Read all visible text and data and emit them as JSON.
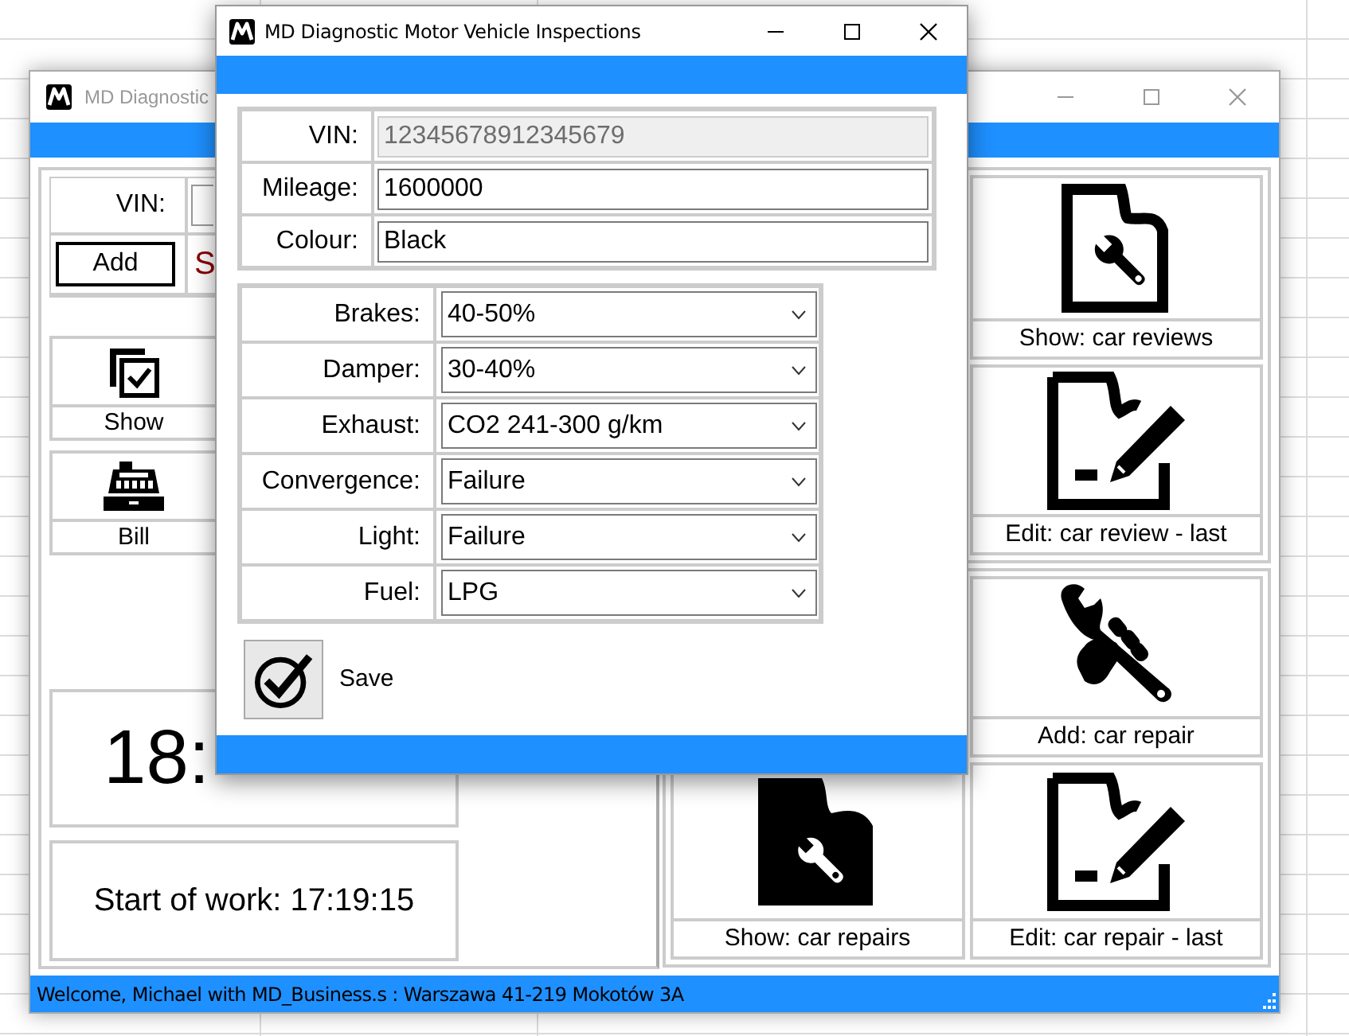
{
  "back_window": {
    "title": "MD Diagnostic",
    "vin_label": "VIN:",
    "add_button": "Add",
    "status_text": "S",
    "tiles": [
      {
        "label": "Show",
        "kind": "checklist"
      },
      {
        "label": "Bill",
        "kind": "register"
      }
    ],
    "clock": "18:",
    "start_of_work": "Start of work: 17:19:15",
    "actions": [
      {
        "label": "Show: car reviews",
        "kind": "doc-wrench"
      },
      {
        "label": "Edit: car review - last",
        "kind": "doc-edit"
      },
      {
        "label": "Add: car repair",
        "kind": "hand-wrench"
      },
      {
        "label": "Show: car repairs",
        "kind": "doc-wrench-filled"
      },
      {
        "label": "Edit: car repair - last",
        "kind": "doc-edit"
      }
    ],
    "status_bar": "Welcome, Michael with MD_Business.s : Warszawa 41-219 Mokotów 3A"
  },
  "dialog": {
    "title": "MD Diagnostic Motor Vehicle Inspections",
    "vehicle_fields": [
      {
        "label": "VIN:",
        "value": "12345678912345679",
        "disabled": true
      },
      {
        "label": "Mileage:",
        "value": "1600000",
        "disabled": false
      },
      {
        "label": "Colour:",
        "value": "Black",
        "disabled": false
      }
    ],
    "ratings": [
      {
        "label": "Brakes:",
        "value": "40-50%"
      },
      {
        "label": "Damper:",
        "value": "30-40%"
      },
      {
        "label": "Exhaust:",
        "value": "CO2 241-300 g/km"
      },
      {
        "label": "Convergence:",
        "value": "Failure"
      },
      {
        "label": "Light:",
        "value": "Failure"
      },
      {
        "label": "Fuel:",
        "value": "LPG"
      }
    ],
    "save_button": "Save"
  }
}
